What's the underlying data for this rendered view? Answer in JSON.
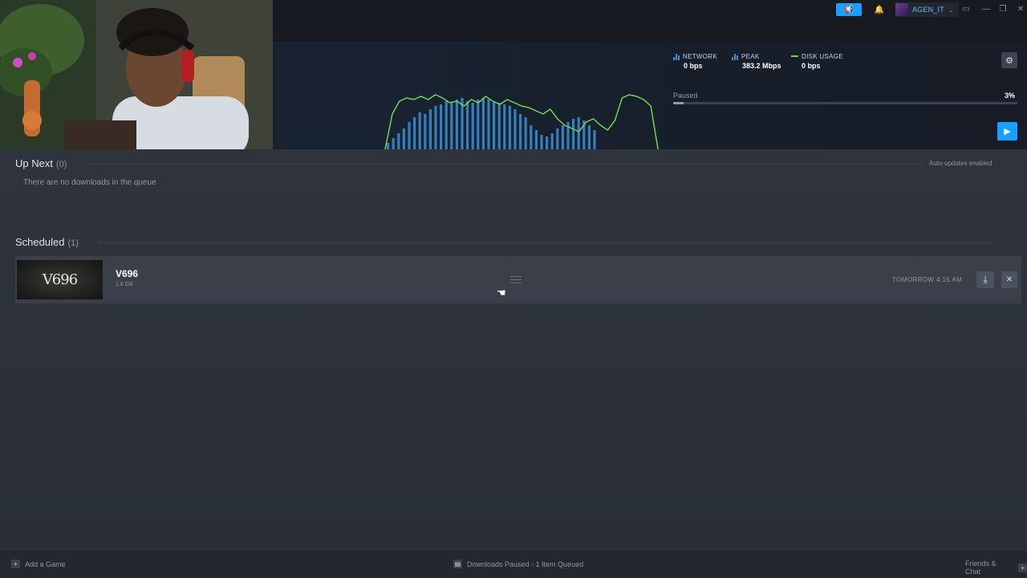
{
  "titlebar": {
    "username": "AGEN_IT",
    "icons": [
      "megaphone-icon",
      "bell-icon",
      "monitor-icon",
      "minimize-icon",
      "maximize-icon",
      "close-icon"
    ]
  },
  "stats": {
    "network_label": "NETWORK",
    "network_value": "0 bps",
    "peak_label": "PEAK",
    "peak_value": "383.2 Mbps",
    "disk_label": "DISK USAGE",
    "disk_value": "0 bps"
  },
  "download_status": {
    "state": "Paused",
    "percent_text": "3%",
    "progress": 0.03
  },
  "up_next": {
    "title": "Up Next",
    "count": "(0)",
    "empty_text": "There are no downloads in the queue",
    "auto_updates": "Auto-updates enabled"
  },
  "scheduled": {
    "title": "Scheduled",
    "count": "(1)",
    "items": [
      {
        "thumb_text": "V696",
        "name": "V696",
        "size": "1.8 GB",
        "time": "TOMORROW 4:15 AM"
      }
    ]
  },
  "footer": {
    "add_game": "Add a Game",
    "status": "Downloads Paused - 1 Item Queued",
    "friends": "Friends & Chat"
  },
  "colors": {
    "accent": "#1a9fff",
    "network_bars": "#3b8fd6",
    "disk_line": "#6fd64a"
  }
}
